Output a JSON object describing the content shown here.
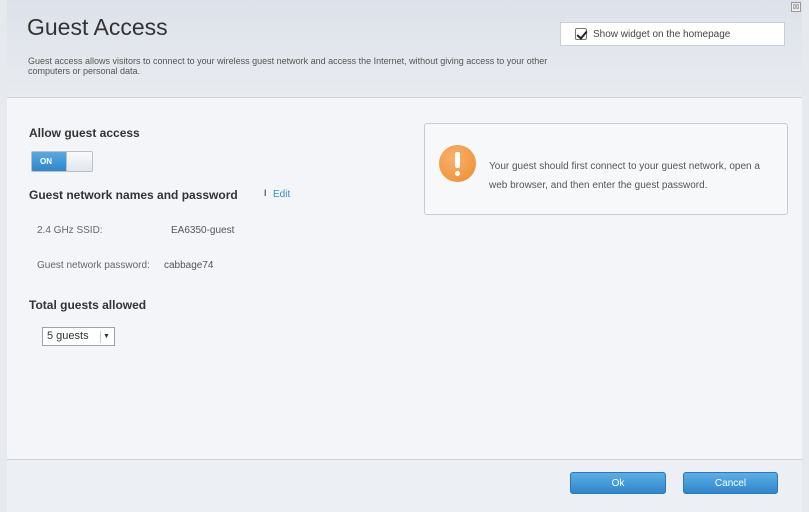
{
  "header": {
    "title": "Guest Access",
    "description": "Guest access allows visitors to connect to your wireless guest network and access the Internet, without giving access to your other computers or personal data.",
    "widget_label": "Show widget on the homepage",
    "widget_checked": true,
    "close_glyph": "⊠"
  },
  "allow_guest": {
    "title": "Allow guest access",
    "toggle_label": "ON",
    "enabled": true
  },
  "network": {
    "title": "Guest network names and password",
    "separator": "I",
    "edit_label": "Edit",
    "ssid_label": "2.4 GHz SSID:",
    "ssid_value": "EA6350-guest",
    "password_label": "Guest network password:",
    "password_value": "cabbage74"
  },
  "guests": {
    "title": "Total guests allowed",
    "selected": "5 guests",
    "arrow_glyph": "▼"
  },
  "info": {
    "message": "Your guest should first connect to your guest network, open a web browser, and then enter the guest password.",
    "icon": "warning-icon"
  },
  "footer": {
    "ok_label": "Ok",
    "cancel_label": "Cancel"
  },
  "colors": {
    "accent": "#2f86cc",
    "warning": "#ee8a2e"
  }
}
